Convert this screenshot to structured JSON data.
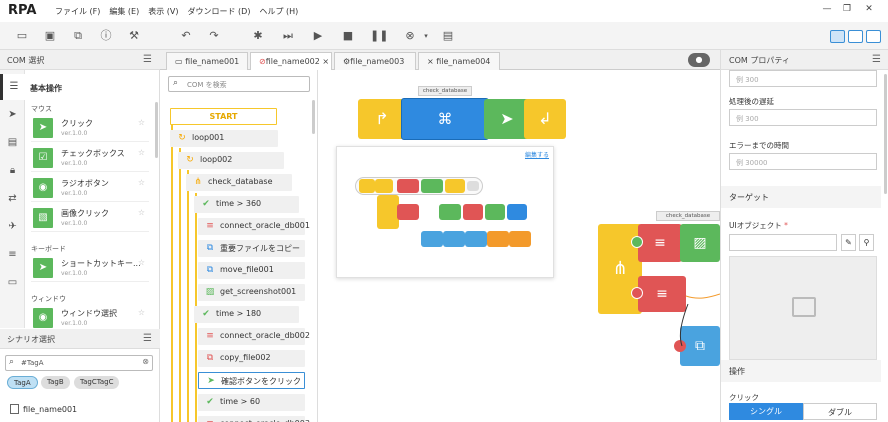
{
  "app": {
    "logo": "RPA"
  },
  "menu": [
    "ファイル (F)",
    "編集 (E)",
    "表示 (V)",
    "ダウンロード (D)",
    "ヘルプ (H)"
  ],
  "left": {
    "com_header": "COM 選択",
    "category": "基本操作",
    "sections": [
      "マウス",
      "キーボード",
      "ウィンドウ"
    ],
    "items": [
      {
        "name": "クリック",
        "ver": "ver.1.0.0"
      },
      {
        "name": "チェックボックス",
        "ver": "ver.1.0.0"
      },
      {
        "name": "ラジオボタン",
        "ver": "ver.1.0.0"
      },
      {
        "name": "画像クリック",
        "ver": "ver.1.0.0"
      },
      {
        "name": "ショートカットキー...",
        "ver": "ver.1.0.0"
      },
      {
        "name": "ウィンドウ選択",
        "ver": "ver.1.0.0"
      }
    ],
    "scenario_header": "シナリオ選択",
    "scenario_search": "#TagA",
    "tags": [
      "TagA",
      "TagB",
      "TagCTagC"
    ],
    "files": [
      "file_name001"
    ]
  },
  "tabs": [
    "file_name001",
    "file_name002",
    "file_name003",
    "file_name004"
  ],
  "tree": {
    "search_placeholder": "COM を検索",
    "nodes": [
      "START",
      "loop001",
      "loop002",
      "check_database",
      "time > 360",
      "connect_oracle_db001",
      "重要ファイルをコピー",
      "move_file001",
      "get_screenshot001",
      "time > 180",
      "connect_oracle_db002",
      "copy_file002",
      "確認ボタンをクリック",
      "time > 60",
      "connect_oracle_db003"
    ]
  },
  "canvas": {
    "label_top": "check_database",
    "label_right": "check_database",
    "edit_link": "編集する"
  },
  "right": {
    "header": "COM プロパティ",
    "placeholder_top": "例 300",
    "label_delay": "処理後の遅延",
    "placeholder_delay": "例 300",
    "label_timeout": "エラーまでの時間",
    "placeholder_timeout": "例 30000",
    "section_target": "ターゲット",
    "label_ui_object": "UIオブジェクト",
    "required_mark": "*",
    "section_ops": "操作",
    "label_click": "クリック",
    "btn_single": "シングル",
    "btn_double": "ダブル"
  },
  "colors": {
    "yellow": "#f6c72b",
    "blue": "#2f8ae0",
    "green": "#5cb85c",
    "red": "#e05555",
    "orange": "#f39a2b",
    "lightblue": "#4aa3df"
  }
}
